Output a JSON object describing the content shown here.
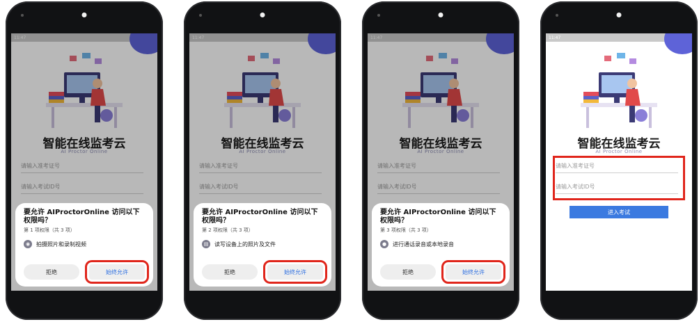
{
  "colors": {
    "accent": "#3b7ae0",
    "highlight": "#e0251b",
    "phone_body": "#111214",
    "blob": "#5e63d8"
  },
  "app": {
    "title": "智能在线监考云",
    "subtitle": "AI Proctor Online"
  },
  "form": {
    "placeholder_ticket": "请输入准考证号",
    "placeholder_exam_id": "请输入考试ID号",
    "enter_button": "进入考试"
  },
  "dialogs": [
    {
      "title": "要允许 AIProctorOnline 访问以下权限吗？",
      "count": "第 1 项权限（共 3 项）",
      "permission": "拍摄照片和录制视频",
      "icon": "camera-icon",
      "deny": "拒绝",
      "allow": "始终允许"
    },
    {
      "title": "要允许 AIProctorOnline 访问以下权限吗？",
      "count": "第 2 项权限（共 3 项）",
      "permission": "读写设备上的照片及文件",
      "icon": "folder-icon",
      "deny": "拒绝",
      "allow": "始终允许"
    },
    {
      "title": "要允许 AIProctorOnline 访问以下权限吗？",
      "count": "第 3 项权限（共 3 项）",
      "permission": "进行通话录音或本地录音",
      "icon": "microphone-icon",
      "deny": "拒绝",
      "allow": "始终允许"
    }
  ]
}
